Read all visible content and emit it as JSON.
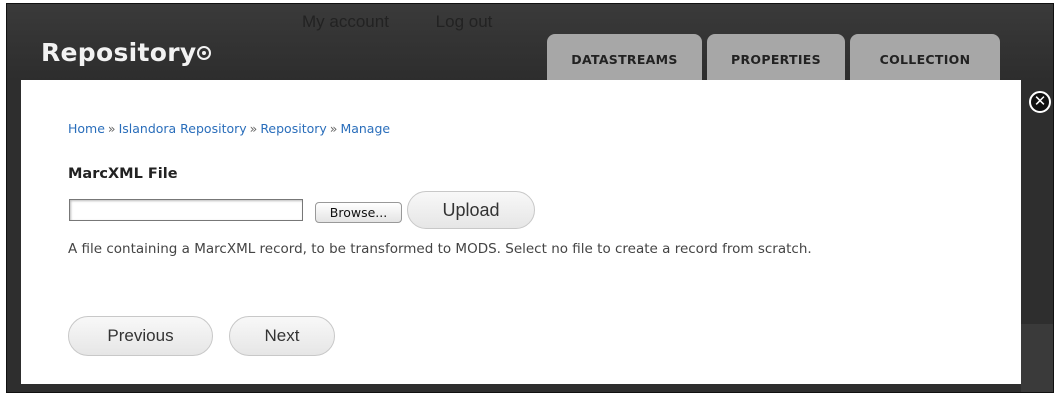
{
  "header": {
    "links": [
      "My account",
      "Log out"
    ],
    "site_title": "Repository",
    "tabs": [
      "DATASTREAMS",
      "PROPERTIES",
      "COLLECTION"
    ]
  },
  "breadcrumb": {
    "items": [
      "Home",
      "Islandora Repository",
      "Repository",
      "Manage"
    ],
    "separator": "»"
  },
  "form": {
    "field_label": "MarcXML File",
    "file_value": "",
    "browse_label": "Browse...",
    "upload_label": "Upload",
    "help_text": "A file containing a MarcXML record, to be transformed to MODS. Select no file to create a record from scratch.",
    "previous_label": "Previous",
    "next_label": "Next"
  },
  "icons": {
    "add": "add-circle-icon",
    "close": "close-icon"
  },
  "colors": {
    "link": "#2a6ebb",
    "header_bg": "#2e2e2e",
    "tab_bg": "#a7a7a7"
  }
}
